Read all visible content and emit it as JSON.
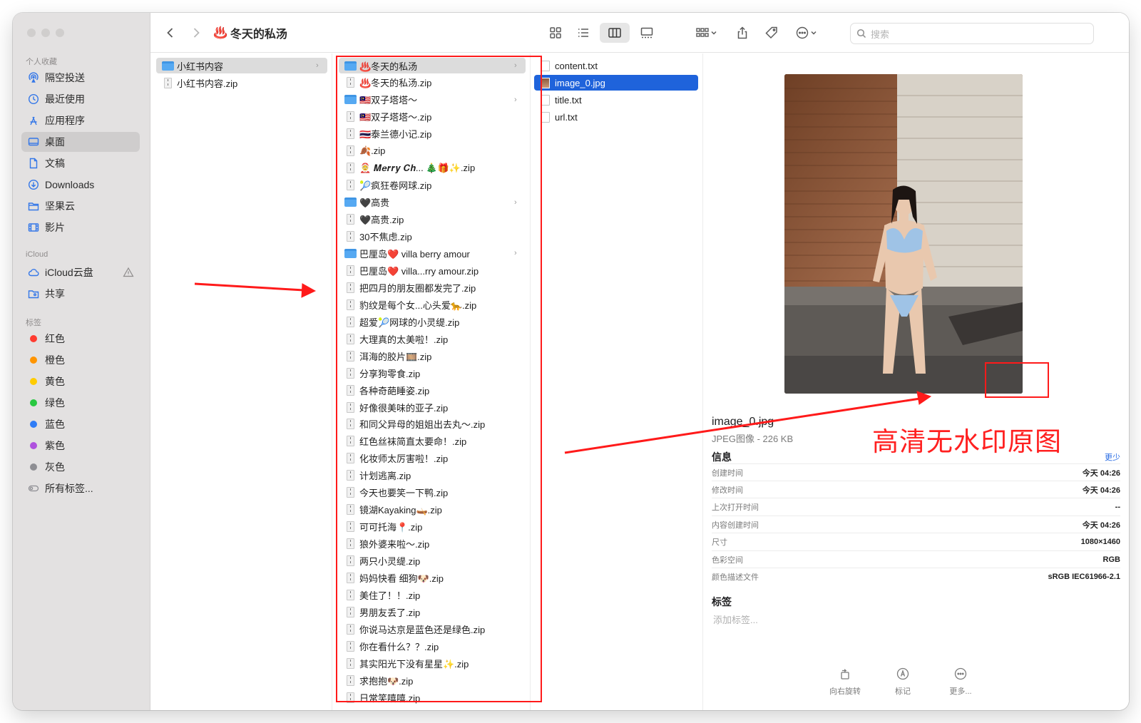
{
  "window": {
    "title": "冬天的私汤",
    "title_emoji": "♨️",
    "search_placeholder": "搜索"
  },
  "sidebar": {
    "favorites_header": "个人收藏",
    "favorites": [
      {
        "label": "隔空投送",
        "icon": "airdrop-icon"
      },
      {
        "label": "最近使用",
        "icon": "clock-icon"
      },
      {
        "label": "应用程序",
        "icon": "apps-icon"
      },
      {
        "label": "桌面",
        "icon": "desktop-icon",
        "active": true
      },
      {
        "label": "文稿",
        "icon": "document-icon"
      },
      {
        "label": "Downloads",
        "icon": "download-icon"
      },
      {
        "label": "坚果云",
        "icon": "folder-icon"
      },
      {
        "label": "影片",
        "icon": "film-icon"
      }
    ],
    "icloud_header": "iCloud",
    "icloud": [
      {
        "label": "iCloud云盘",
        "icon": "cloud-icon"
      },
      {
        "label": "共享",
        "icon": "shared-folder-icon"
      }
    ],
    "tags_header": "标签",
    "tags": [
      {
        "label": "红色",
        "color": "#ff3b30"
      },
      {
        "label": "橙色",
        "color": "#ff9500"
      },
      {
        "label": "黄色",
        "color": "#ffcc00"
      },
      {
        "label": "绿色",
        "color": "#28c840"
      },
      {
        "label": "蓝色",
        "color": "#2f7cf6"
      },
      {
        "label": "紫色",
        "color": "#af52de"
      },
      {
        "label": "灰色",
        "color": "#8e8e93"
      }
    ],
    "all_tags": "所有标签..."
  },
  "column1": [
    {
      "name": "小红书内容",
      "kind": "folder",
      "expand": true,
      "highlight": true
    },
    {
      "name": "小红书内容.zip",
      "kind": "zip"
    }
  ],
  "column2": [
    {
      "name": "♨️冬天的私汤",
      "kind": "folder",
      "expand": true,
      "highlight": true
    },
    {
      "name": "♨️冬天的私汤.zip",
      "kind": "zip"
    },
    {
      "name": "🇲🇾双子塔塔～",
      "kind": "folder",
      "expand": true
    },
    {
      "name": "🇲🇾双子塔塔～.zip",
      "kind": "zip"
    },
    {
      "name": "🇹🇭泰兰德小记.zip",
      "kind": "zip"
    },
    {
      "name": "🍂.zip",
      "kind": "zip"
    },
    {
      "name": "🤶 𝑴𝒆𝒓𝒓𝒚 𝑪𝒉... 🎄🎁✨.zip",
      "kind": "zip"
    },
    {
      "name": "🎾疯狂卷网球.zip",
      "kind": "zip"
    },
    {
      "name": "🖤高贵",
      "kind": "folder",
      "expand": true
    },
    {
      "name": "🖤高贵.zip",
      "kind": "zip"
    },
    {
      "name": "30不焦虑.zip",
      "kind": "zip"
    },
    {
      "name": "巴厘岛❤️ villa berry amour",
      "kind": "folder",
      "expand": true
    },
    {
      "name": "巴厘岛❤️ villa...rry amour.zip",
      "kind": "zip"
    },
    {
      "name": "把四月的朋友圈都发完了.zip",
      "kind": "zip"
    },
    {
      "name": "豹纹是每个女...心头爱🐆.zip",
      "kind": "zip"
    },
    {
      "name": "超爱🎾网球的小灵缇.zip",
      "kind": "zip"
    },
    {
      "name": "大理真的太美啦！.zip",
      "kind": "zip"
    },
    {
      "name": "洱海的胶片🎞️.zip",
      "kind": "zip"
    },
    {
      "name": "分享狗零食.zip",
      "kind": "zip"
    },
    {
      "name": "各种奇葩睡姿.zip",
      "kind": "zip"
    },
    {
      "name": "好像很美味的亚子.zip",
      "kind": "zip"
    },
    {
      "name": "和同父异母的姐姐出去丸～.zip",
      "kind": "zip"
    },
    {
      "name": "红色丝袜简直太要命！.zip",
      "kind": "zip"
    },
    {
      "name": "化妆师太厉害啦！.zip",
      "kind": "zip"
    },
    {
      "name": "计划逃离.zip",
      "kind": "zip"
    },
    {
      "name": "今天也要笑一下鸭.zip",
      "kind": "zip"
    },
    {
      "name": "镜湖Kayaking🛶.zip",
      "kind": "zip"
    },
    {
      "name": "可可托海📍.zip",
      "kind": "zip"
    },
    {
      "name": "狼外婆来啦～.zip",
      "kind": "zip"
    },
    {
      "name": "两只小灵缇.zip",
      "kind": "zip"
    },
    {
      "name": "妈妈快看 细狗🐶.zip",
      "kind": "zip"
    },
    {
      "name": "美住了！！.zip",
      "kind": "zip"
    },
    {
      "name": "男朋友丢了.zip",
      "kind": "zip"
    },
    {
      "name": "你说马达京是蓝色还是绿色.zip",
      "kind": "zip"
    },
    {
      "name": "你在看什么？？.zip",
      "kind": "zip"
    },
    {
      "name": "其实阳光下没有星星✨.zip",
      "kind": "zip"
    },
    {
      "name": "求抱抱🐶.zip",
      "kind": "zip"
    },
    {
      "name": "日常笑嘻嘻.zip",
      "kind": "zip"
    }
  ],
  "column3": [
    {
      "name": "content.txt",
      "kind": "txt"
    },
    {
      "name": "image_0.jpg",
      "kind": "image",
      "selected": true
    },
    {
      "name": "title.txt",
      "kind": "txt"
    },
    {
      "name": "url.txt",
      "kind": "txt"
    }
  ],
  "preview": {
    "file_name": "image_0.jpg",
    "file_type": "JPEG图像 - 226 KB",
    "info_header": "信息",
    "less_label": "更少",
    "info": [
      {
        "key": "创建时间",
        "value": "今天 04:26"
      },
      {
        "key": "修改时间",
        "value": "今天 04:26"
      },
      {
        "key": "上次打开时间",
        "value": "--"
      },
      {
        "key": "内容创建时间",
        "value": "今天 04:26"
      },
      {
        "key": "尺寸",
        "value": "1080×1460"
      },
      {
        "key": "色彩空间",
        "value": "RGB"
      },
      {
        "key": "颜色描述文件",
        "value": "sRGB IEC61966-2.1"
      }
    ],
    "tags_header": "标签",
    "tags_placeholder": "添加标签...",
    "actions": [
      {
        "label": "向右旋转",
        "icon": "rotate-right-icon"
      },
      {
        "label": "标记",
        "icon": "markup-icon"
      },
      {
        "label": "更多...",
        "icon": "more-icon"
      }
    ]
  },
  "annotation": {
    "text": "高清无水印原图",
    "color": "#ff2020"
  }
}
